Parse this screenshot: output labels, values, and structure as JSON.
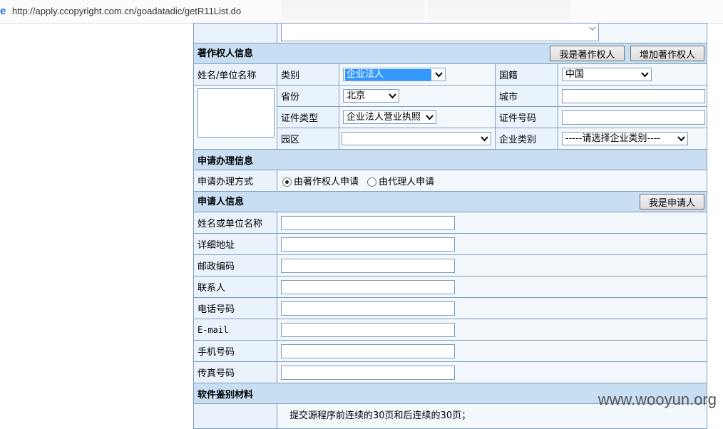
{
  "browser": {
    "url": "http://apply.ccopyright.com.cn/goadatadic/getR11List.do"
  },
  "copyright_owner": {
    "title": "著作权人信息",
    "btn_i_am_owner": "我是著作权人",
    "btn_add_owner": "增加著作权人",
    "name_label": "姓名/单位名称",
    "category_label": "类别",
    "category_value": "企业法人",
    "nationality_label": "国籍",
    "nationality_value": "中国",
    "province_label": "省份",
    "province_value": "北京",
    "city_label": "城市",
    "id_type_label": "证件类型",
    "id_type_value": "企业法人营业执照",
    "id_number_label": "证件号码",
    "park_label": "园区",
    "park_value": "",
    "enterprise_type_label": "企业类别",
    "enterprise_type_value": "-----请选择企业类别----"
  },
  "application": {
    "title": "申请办理信息",
    "method_label": "申请办理方式",
    "option_owner": "由著作权人申请",
    "option_agent": "由代理人申请"
  },
  "applicant": {
    "title": "申请人信息",
    "btn_i_am_applicant": "我是申请人",
    "fields": [
      {
        "label": "姓名或单位名称"
      },
      {
        "label": "详细地址"
      },
      {
        "label": "邮政编码"
      },
      {
        "label": "联系人"
      },
      {
        "label": "电话号码"
      },
      {
        "label": "E-mail"
      },
      {
        "label": "手机号码"
      },
      {
        "label": "传真号码"
      }
    ]
  },
  "materials": {
    "title": "软件鉴别材料",
    "note": "提交源程序前连续的30页和后连续的30页；"
  },
  "watermark": "www.wooyun.org"
}
